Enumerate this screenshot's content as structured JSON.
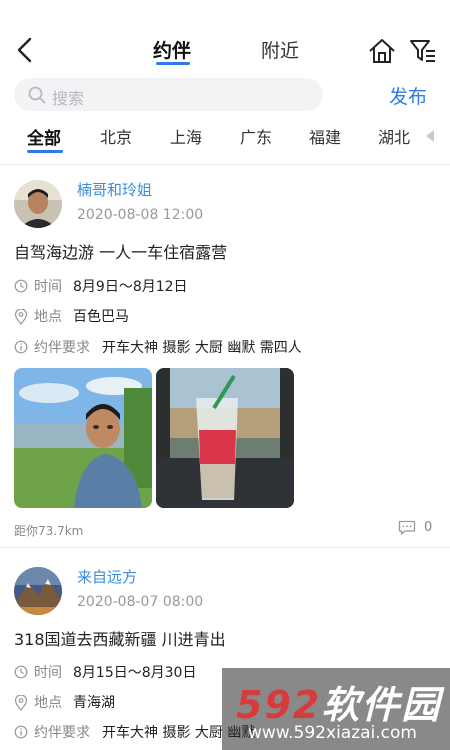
{
  "header": {
    "tabs": [
      "约伴",
      "附近"
    ],
    "active_tab": 0
  },
  "search": {
    "placeholder": "搜索"
  },
  "publish_label": "发布",
  "categories": [
    "全部",
    "北京",
    "上海",
    "广东",
    "福建",
    "湖北"
  ],
  "posts": [
    {
      "name": "楠哥和玲姐",
      "datetime": "2020-08-08 12:00",
      "title": "自驾海边游 一人一车住宿露营",
      "time_label": "时间",
      "time_value": "8月9日～8月12日",
      "place_label": "地点",
      "place_value": "百色巴马",
      "req_label": "约伴要求",
      "req_value": "开车大神 摄影 大厨 幽默 需四人",
      "distance": "距你73.7km",
      "comments": "0"
    },
    {
      "name": "来自远方",
      "datetime": "2020-08-07 08:00",
      "title": "318国道去西藏新疆 川进青出",
      "time_label": "时间",
      "time_value": "8月15日～8月30日",
      "place_label": "地点",
      "place_value": "青海湖",
      "req_label": "约伴要求",
      "req_value": "开车大神 摄影 大厨 幽默"
    }
  ],
  "watermark": {
    "big_num": "592",
    "big_text": "软件园",
    "url": "www.592xiazai.com"
  }
}
